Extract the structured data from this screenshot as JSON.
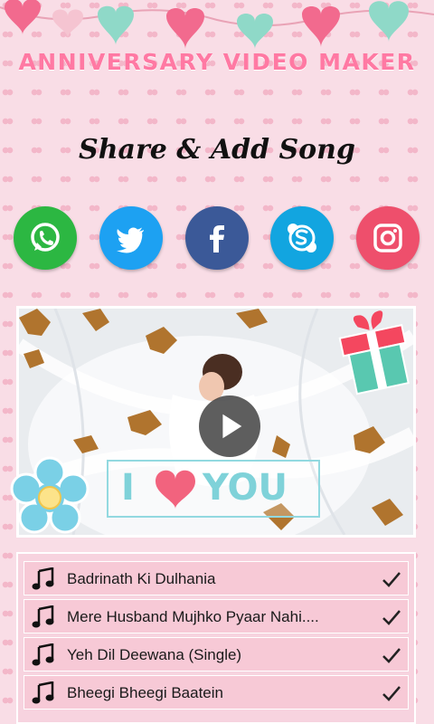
{
  "app": {
    "title": "ANNIVERSARY VIDEO MAKER",
    "section_heading": "Share & Add Song"
  },
  "share_buttons": [
    {
      "name": "whatsapp",
      "icon": "whatsapp-icon",
      "color": "#2cb742"
    },
    {
      "name": "twitter",
      "icon": "twitter-icon",
      "color": "#1da1f2"
    },
    {
      "name": "facebook",
      "icon": "facebook-icon",
      "color": "#3b5998"
    },
    {
      "name": "skype",
      "icon": "skype-icon",
      "color": "#12a5e0"
    },
    {
      "name": "instagram",
      "icon": "instagram-icon",
      "color": "#ee4f6c"
    }
  ],
  "video": {
    "overlay_text_left": "I",
    "overlay_text_right": "YOU",
    "state": "paused"
  },
  "songs": [
    {
      "title": "Badrinath Ki Dulhania",
      "checked": true
    },
    {
      "title": "Mere Husband Mujhko Pyaar Nahi....",
      "checked": true
    },
    {
      "title": "Yeh Dil Deewana (Single)",
      "checked": true
    },
    {
      "title": "Bheegi Bheegi Baatein",
      "checked": true
    }
  ],
  "colors": {
    "accent_pink": "#ff79a3",
    "banner_mint": "#8fd9c8",
    "background": "#f9dde6"
  }
}
